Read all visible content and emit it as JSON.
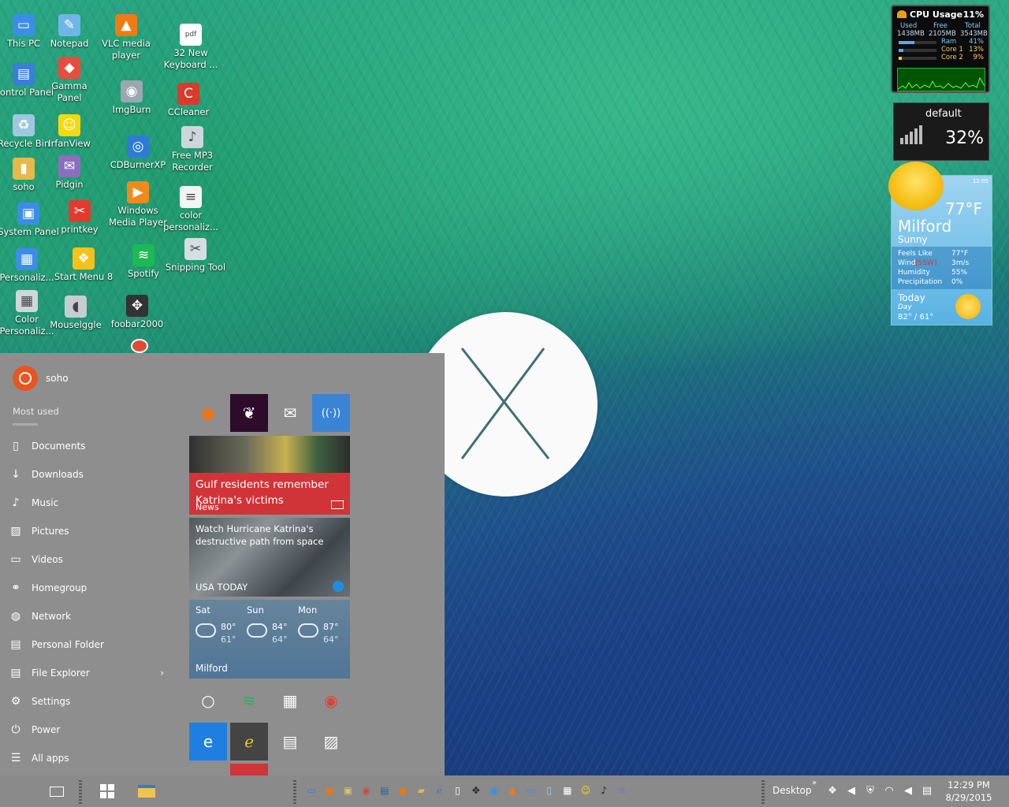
{
  "desktop": {
    "icons": [
      {
        "label": "This PC",
        "icon": "this-pc-icon",
        "color": "#3a8ee6",
        "glyph": "▭"
      },
      {
        "label": "Notepad",
        "icon": "notepad-icon",
        "color": "#6fb5e8",
        "glyph": "✎"
      },
      {
        "label": "VLC media player",
        "icon": "vlc-icon",
        "color": "#f07b12",
        "glyph": "▲"
      },
      {
        "label": "32 New Keyboard ...",
        "icon": "pdf-file-icon",
        "color": "#ffffff",
        "glyph": "pdf"
      },
      {
        "label": "Control Panel",
        "icon": "control-panel-icon",
        "color": "#3a7fd5",
        "glyph": "▤"
      },
      {
        "label": "Gamma Panel",
        "icon": "gamma-panel-icon",
        "color": "#e94b3c",
        "glyph": "◆"
      },
      {
        "label": "ImgBurn",
        "icon": "imgburn-icon",
        "color": "#9aa7b0",
        "glyph": "◉"
      },
      {
        "label": "CCleaner",
        "icon": "ccleaner-icon",
        "color": "#d83b2a",
        "glyph": "C"
      },
      {
        "label": "Recycle Bin",
        "icon": "recycle-bin-icon",
        "color": "#9fc7e0",
        "glyph": "♻"
      },
      {
        "label": "IrfanView",
        "icon": "irfanview-icon",
        "color": "#f5d90f",
        "glyph": "☺"
      },
      {
        "label": "CDBurnerXP",
        "icon": "cdburnerxp-icon",
        "color": "#2e7bd6",
        "glyph": "◎"
      },
      {
        "label": "Free MP3 Recorder",
        "icon": "mp3-recorder-icon",
        "color": "#cfd6db",
        "glyph": "♪"
      },
      {
        "label": "soho",
        "icon": "user-folder-icon",
        "color": "#e7b84a",
        "glyph": "▮"
      },
      {
        "label": "Pidgin",
        "icon": "pidgin-icon",
        "color": "#8b6fbf",
        "glyph": "✉"
      },
      {
        "label": "Windows Media Player",
        "icon": "media-player-icon",
        "color": "#f08a1c",
        "glyph": "▶"
      },
      {
        "label": "color personaliz...",
        "icon": "text-file-icon",
        "color": "#f4f4f4",
        "glyph": "≡"
      },
      {
        "label": "System Panel",
        "icon": "system-panel-icon",
        "color": "#3a8ee6",
        "glyph": "▣"
      },
      {
        "label": "printkey",
        "icon": "printkey-icon",
        "color": "#e23b2e",
        "glyph": "✂"
      },
      {
        "label": "Spotify",
        "icon": "spotify-icon",
        "color": "#1db954",
        "glyph": "≋"
      },
      {
        "label": "Snipping Tool",
        "icon": "snipping-tool-icon",
        "color": "#d7dde2",
        "glyph": "✂"
      },
      {
        "label": "Personaliz...",
        "icon": "personalize-icon",
        "color": "#3a8ee6",
        "glyph": "▦"
      },
      {
        "label": "Start Menu 8",
        "icon": "start-menu-8-icon",
        "color": "#f6c21a",
        "glyph": "❖"
      },
      {
        "label": "foobar2000",
        "icon": "foobar2000-icon",
        "color": "#333333",
        "glyph": "✥"
      },
      {
        "label": "Color Personaliz...",
        "icon": "color-personalize-icon",
        "color": "#d0d6da",
        "glyph": "▦"
      },
      {
        "label": "Mouselggle",
        "icon": "mouse-jiggle-icon",
        "color": "#c6ccd0",
        "glyph": "◖"
      }
    ]
  },
  "gadgets": {
    "cpu": {
      "title": "CPU Usage",
      "percent": "11%",
      "col_used": "Used",
      "col_free": "Free",
      "col_total": "Total",
      "used": "1438MB",
      "free": "2105MB",
      "total": "3543MB",
      "ram_label": "Ram",
      "ram_pct": "41%",
      "ram_level": 0.41,
      "core1_label": "Core 1",
      "core1_pct": "13%",
      "core1_level": 0.13,
      "core2_label": "Core 2",
      "core2_pct": "9%",
      "core2_level": 0.09
    },
    "network": {
      "name": "default",
      "percent": "32%"
    },
    "weather": {
      "time": "12:05",
      "temp": "77°F",
      "city": "Milford",
      "condition": "Sunny",
      "feels_like_label": "Feels Like",
      "feels_like": "77°F",
      "wind_label": "Wind",
      "wind_dir": "[SSW]",
      "wind": "3m/s",
      "humidity_label": "Humidity",
      "humidity": "55%",
      "precip_label": "Precipitation",
      "precip": "0%",
      "today_label": "Today",
      "day_label": "Day",
      "hilo": "82° / 61°"
    }
  },
  "start_menu": {
    "user": "soho",
    "most_used_label": "Most used",
    "items": [
      {
        "label": "Documents",
        "icon": "document-icon",
        "glyph": "▯"
      },
      {
        "label": "Downloads",
        "icon": "download-icon",
        "glyph": "↓"
      },
      {
        "label": "Music",
        "icon": "music-icon",
        "glyph": "♪"
      },
      {
        "label": "Pictures",
        "icon": "pictures-icon",
        "glyph": "▨"
      },
      {
        "label": "Videos",
        "icon": "videos-icon",
        "glyph": "▭"
      },
      {
        "label": "Homegroup",
        "icon": "homegroup-icon",
        "glyph": "⚭"
      },
      {
        "label": "Network",
        "icon": "network-icon",
        "glyph": "◍"
      },
      {
        "label": "Personal Folder",
        "icon": "personal-folder-icon",
        "glyph": "▤"
      },
      {
        "label": "File Explorer",
        "icon": "file-explorer-icon",
        "glyph": "▤"
      },
      {
        "label": "Settings",
        "icon": "settings-gear-icon",
        "glyph": "⚙"
      },
      {
        "label": "Power",
        "icon": "power-icon",
        "glyph": "⏻"
      },
      {
        "label": "All apps",
        "icon": "all-apps-icon",
        "glyph": "☰"
      }
    ],
    "file_explorer_chevron": "›",
    "tiles": {
      "top_row": [
        {
          "name": "firefox-tile",
          "icon": "firefox-icon",
          "bg": "#8e8e8e",
          "glyph": "●",
          "color": "#e8761b"
        },
        {
          "name": "iheartradio-tile",
          "icon": "iheartradio-icon",
          "bg": "#2d0b2b",
          "glyph": "❦",
          "color": "#ffffff"
        },
        {
          "name": "mail-tile",
          "icon": "mail-icon",
          "bg": "#8e8e8e",
          "glyph": "✉",
          "color": "#ffffff"
        },
        {
          "name": "podcast-tile",
          "icon": "podcast-icon",
          "bg": "#3a84d6",
          "glyph": "((·))",
          "color": "#ffffff"
        }
      ],
      "news": {
        "headline": "Gulf residents remember Katrina's victims",
        "label": "News"
      },
      "usatoday": {
        "headline": "Watch Hurricane Katrina's destructive path from space",
        "label": "USA TODAY"
      },
      "weather": {
        "days": [
          {
            "day": "Sat",
            "hi": "80°",
            "lo": "61°"
          },
          {
            "day": "Sun",
            "hi": "84°",
            "lo": "64°"
          },
          {
            "day": "Mon",
            "hi": "87°",
            "lo": "64°"
          }
        ],
        "city": "Milford"
      },
      "row4": [
        {
          "name": "cortana-tile",
          "icon": "cortana-ring-icon",
          "bg": "#8e8e8e",
          "glyph": "○",
          "color": "#ffffff"
        },
        {
          "name": "spotify-tile",
          "icon": "spotify-icon",
          "bg": "#8e8e8e",
          "glyph": "≋",
          "color": "#1db954"
        },
        {
          "name": "calendar-tile",
          "icon": "calendar-icon",
          "bg": "#8e8e8e",
          "glyph": "▦",
          "color": "#ffffff"
        },
        {
          "name": "chrome-tile",
          "icon": "chrome-icon",
          "bg": "#8e8e8e",
          "glyph": "◉",
          "color": "#db4437"
        }
      ],
      "row5": [
        {
          "name": "edge-tile",
          "icon": "edge-icon",
          "bg": "#1e7fe0",
          "glyph": "e",
          "color": "#ffffff"
        },
        {
          "name": "internet-explorer-tile",
          "icon": "internet-explorer-icon",
          "bg": "#444444",
          "glyph": "ℯ",
          "color": "#f5c518"
        },
        {
          "name": "movies-tile",
          "icon": "movies-clapper-icon",
          "bg": "#8e8e8e",
          "glyph": "▤",
          "color": "#ffffff"
        },
        {
          "name": "photos-tile",
          "icon": "photos-icon",
          "bg": "#8e8e8e",
          "glyph": "▨",
          "color": "#ffffff"
        }
      ]
    }
  },
  "taskbar": {
    "desktop_label": "Desktop",
    "overflow": "»",
    "time": "12:29 PM",
    "date": "8/29/2015",
    "quick_launch": [
      {
        "name": "show-desktop-icon",
        "glyph": "▭",
        "color": "#2a7fd8"
      },
      {
        "name": "firefox-icon",
        "glyph": "●",
        "color": "#e8761b"
      },
      {
        "name": "tool-icon",
        "glyph": "▣",
        "color": "#d6c46a"
      },
      {
        "name": "chrome-icon",
        "glyph": "◉",
        "color": "#db4437"
      },
      {
        "name": "window-icon",
        "glyph": "▤",
        "color": "#2a5fa8"
      },
      {
        "name": "firefox-alt-icon",
        "glyph": "●",
        "color": "#e8761b"
      },
      {
        "name": "folder-icon",
        "glyph": "▰",
        "color": "#e7b84a"
      },
      {
        "name": "ie-icon",
        "glyph": "ℯ",
        "color": "#2a7fd8"
      },
      {
        "name": "file-icon",
        "glyph": "▯",
        "color": "#ffffff"
      },
      {
        "name": "move-icon",
        "glyph": "✥",
        "color": "#222222"
      },
      {
        "name": "panel-icon",
        "glyph": "▣",
        "color": "#3a8ee6"
      },
      {
        "name": "vlc-icon",
        "glyph": "▲",
        "color": "#f07b12"
      },
      {
        "name": "screen-icon",
        "glyph": "▭",
        "color": "#3a8ee6"
      },
      {
        "name": "notepad-icon",
        "glyph": "▯",
        "color": "#9ad0f0"
      },
      {
        "name": "keyboard-icon",
        "glyph": "▦",
        "color": "#ffffff"
      },
      {
        "name": "irfanview-icon",
        "glyph": "☺",
        "color": "#f5d90f"
      },
      {
        "name": "mp3-icon",
        "glyph": "♪",
        "color": "#222222"
      },
      {
        "name": "pidgin-icon",
        "glyph": "✉",
        "color": "#8b6fbf"
      }
    ],
    "tray": [
      {
        "name": "color-tray-icon",
        "glyph": "❖"
      },
      {
        "name": "volume-speaker-icon",
        "glyph": "◀"
      },
      {
        "name": "shield-icon",
        "glyph": "⛨"
      },
      {
        "name": "wifi-icon",
        "glyph": "◠"
      },
      {
        "name": "speaker-icon",
        "glyph": "◀"
      },
      {
        "name": "action-center-icon",
        "glyph": "▤"
      }
    ]
  }
}
